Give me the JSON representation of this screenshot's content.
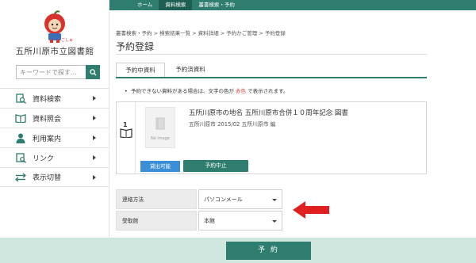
{
  "sidebar": {
    "library_name": "五所川原市立図書館",
    "search_placeholder": "キーワードで探す...",
    "items": [
      {
        "label": "資料検索",
        "icon": "search-book-icon"
      },
      {
        "label": "資料照会",
        "icon": "open-book-icon"
      },
      {
        "label": "利用案内",
        "icon": "person-icon"
      },
      {
        "label": "リンク",
        "icon": "link-icon"
      },
      {
        "label": "表示切替",
        "icon": "swap-arrows-icon"
      }
    ]
  },
  "topnav": [
    {
      "label": "ホーム",
      "active": false
    },
    {
      "label": "資料検索",
      "active": true
    },
    {
      "label": "叢書検索・予約",
      "active": false
    }
  ],
  "breadcrumb": "叢書検索・予約 > 検索結果一覧 > 資料詳細 > 予約かご管理 > 予約登録",
  "page_title": "予約登録",
  "tabs": [
    "予約中資料",
    "予約済資料"
  ],
  "notice": {
    "before": "予約できない資料がある場合は、文字の色が",
    "red_word": "赤色",
    "after": "で表示されます。"
  },
  "item": {
    "number": "1",
    "noimage_label": "No image",
    "title": "五所川原市の地名 五所川原市合併１０周年記念 図書",
    "meta": "五所川原市 2015/02    五所川原市 編",
    "availability": "貸出可能",
    "cancel_label": "予約中止"
  },
  "form": {
    "contact_label": "連絡方法",
    "contact_value": "パソコンメール",
    "pickup_label": "受取館",
    "pickup_value": "本館"
  },
  "reserve_button": "予 約",
  "colors": {
    "brand_green": "#2e7d6e",
    "annotation_red": "#e02020",
    "available_blue": "#3b8fd6"
  }
}
